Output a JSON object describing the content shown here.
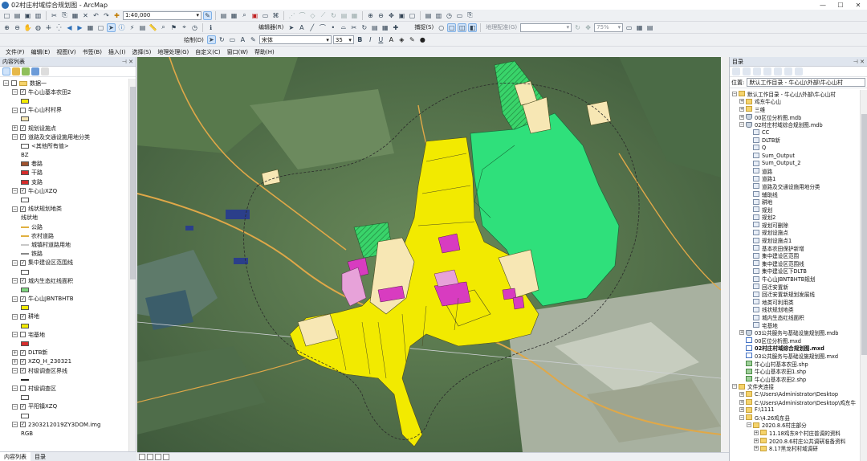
{
  "window": {
    "title": "02村庄村域综合规划图 - ArcMap",
    "controls": [
      "—",
      "☐",
      "✕"
    ]
  },
  "toolbar": {
    "scale": "1:40,000",
    "draw_label": "绘制(D)",
    "font_name": "宋体",
    "font_size": "35",
    "editor_label": "编辑器(R)",
    "snap_label": "捕捉(S)",
    "georef_label": "地理配准(G)",
    "zoom_pct": "75%"
  },
  "menu": [
    "文件(F)",
    "编辑(E)",
    "视图(V)",
    "书签(B)",
    "插入(I)",
    "选择(S)",
    "地理处理(G)",
    "自定义(C)",
    "窗口(W)",
    "帮助(H)"
  ],
  "toc": {
    "title": "内容列表",
    "tabs": [
      "内容列表",
      "目录"
    ],
    "rows": [
      {
        "depth": 0,
        "exp": "−",
        "chk": false,
        "icon": "folder",
        "label": "数据一"
      },
      {
        "depth": 1,
        "exp": "−",
        "chk": true,
        "label": "牛心山基本农田2"
      },
      {
        "depth": 2,
        "swatch": "#f2ea00",
        "label": ""
      },
      {
        "depth": 1,
        "exp": "−",
        "chk": false,
        "label": "牛心山村村界"
      },
      {
        "depth": 2,
        "swatch": "#f7e7b4",
        "label": ""
      },
      {
        "depth": 1,
        "exp": "+",
        "chk": true,
        "label": "规划设施点"
      },
      {
        "depth": 1,
        "exp": "−",
        "chk": true,
        "label": "道路及交通设施用地分类"
      },
      {
        "depth": 2,
        "swatch": "#ffffff",
        "label": "<其他所有值>"
      },
      {
        "depth": 2,
        "label": "BZ"
      },
      {
        "depth": 2,
        "swatch": "#a0522d",
        "label": "巷路"
      },
      {
        "depth": 2,
        "swatch": "#d62c2c",
        "label": "干路"
      },
      {
        "depth": 2,
        "swatch": "#d62c2c",
        "label": "支路"
      },
      {
        "depth": 1,
        "exp": "−",
        "chk": true,
        "label": "牛心山XZQ"
      },
      {
        "depth": 2,
        "swatch": "#ffffff",
        "label": ""
      },
      {
        "depth": 1,
        "exp": "−",
        "chk": true,
        "label": "线状规划地类"
      },
      {
        "depth": 2,
        "label": "线状地"
      },
      {
        "depth": 2,
        "line": "#e0b040",
        "label": "公路"
      },
      {
        "depth": 2,
        "line": "#e0b040",
        "label": "农村道路"
      },
      {
        "depth": 2,
        "line": "#c8c8c8",
        "label": "城镇村道路用地"
      },
      {
        "depth": 2,
        "line": "#888888",
        "label": "铁路"
      },
      {
        "depth": 1,
        "exp": "−",
        "chk": true,
        "label": "集中建设区范围线"
      },
      {
        "depth": 2,
        "swatch": "#ffffff",
        "label": ""
      },
      {
        "depth": 1,
        "exp": "−",
        "chk": true,
        "label": "城内生态红线面积"
      },
      {
        "depth": 2,
        "swatch": "#7fd67f",
        "label": ""
      },
      {
        "depth": 1,
        "exp": "−",
        "chk": true,
        "label": "牛心山JBNTBHTB"
      },
      {
        "depth": 2,
        "swatch": "#f2ea00",
        "label": ""
      },
      {
        "depth": 1,
        "exp": "−",
        "chk": true,
        "label": "耕地"
      },
      {
        "depth": 2,
        "swatch": "#f2ea00",
        "label": ""
      },
      {
        "depth": 1,
        "exp": "−",
        "chk": false,
        "label": "宅基地"
      },
      {
        "depth": 2,
        "swatch": "#d62c2c",
        "label": ""
      },
      {
        "depth": 1,
        "exp": "+",
        "chk": true,
        "label": "DLTB新"
      },
      {
        "depth": 1,
        "exp": "+",
        "chk": true,
        "label": "XZQ_H_230321"
      },
      {
        "depth": 1,
        "exp": "−",
        "chk": true,
        "label": "村级调查区界线"
      },
      {
        "depth": 2,
        "line": "#222222",
        "label": ""
      },
      {
        "depth": 1,
        "exp": "−",
        "chk": false,
        "label": "村级调查区"
      },
      {
        "depth": 2,
        "swatch": "#ffffff",
        "label": ""
      },
      {
        "depth": 1,
        "exp": "−",
        "chk": true,
        "label": "平阳镇XZQ"
      },
      {
        "depth": 2,
        "swatch": "#ffffff",
        "label": ""
      },
      {
        "depth": 1,
        "exp": "−",
        "chk": true,
        "label": "2303212019ZY3DOM.img"
      },
      {
        "depth": 2,
        "label": "RGB"
      }
    ]
  },
  "catalog": {
    "title": "目录",
    "location_label": "位置:",
    "location_value": "默认工作目录 - 牛心山\\外部\\牛心山村",
    "rows": [
      {
        "depth": 0,
        "exp": "−",
        "icon": "folder",
        "label": "默认工作目录 - 牛心山\\外部\\牛心山村"
      },
      {
        "depth": 1,
        "exp": "+",
        "icon": "folder",
        "label": "鸡东牛心山"
      },
      {
        "depth": 1,
        "exp": "+",
        "icon": "folder",
        "label": "三维"
      },
      {
        "depth": 1,
        "exp": "+",
        "icon": "db",
        "label": "00区位分析图.mdb"
      },
      {
        "depth": 1,
        "exp": "−",
        "icon": "db",
        "label": "02村庄村域综合规划图.mdb"
      },
      {
        "depth": 2,
        "icon": "fc",
        "label": "CC"
      },
      {
        "depth": 2,
        "icon": "fc",
        "label": "DLTB新"
      },
      {
        "depth": 2,
        "icon": "fc",
        "label": "Q"
      },
      {
        "depth": 2,
        "icon": "fc",
        "label": "Sum_Output"
      },
      {
        "depth": 2,
        "icon": "fc",
        "label": "Sum_Output_2"
      },
      {
        "depth": 2,
        "icon": "fc",
        "label": "道路"
      },
      {
        "depth": 2,
        "icon": "fc",
        "label": "道路1"
      },
      {
        "depth": 2,
        "icon": "fc",
        "label": "道路及交通设施用地分类"
      },
      {
        "depth": 2,
        "icon": "fc",
        "label": "辅助线"
      },
      {
        "depth": 2,
        "icon": "fc",
        "label": "耕地"
      },
      {
        "depth": 2,
        "icon": "fc",
        "label": "规划"
      },
      {
        "depth": 2,
        "icon": "fc",
        "label": "规划2"
      },
      {
        "depth": 2,
        "icon": "fc",
        "label": "规划可删除"
      },
      {
        "depth": 2,
        "icon": "fc",
        "label": "规划设施点"
      },
      {
        "depth": 2,
        "icon": "fc",
        "label": "规划设施点1"
      },
      {
        "depth": 2,
        "icon": "fc",
        "label": "基本农田保护新增"
      },
      {
        "depth": 2,
        "icon": "fc",
        "label": "集中建设区范围"
      },
      {
        "depth": 2,
        "icon": "fc",
        "label": "集中建设区范围线"
      },
      {
        "depth": 2,
        "icon": "fc",
        "label": "集中建设区下DLTB"
      },
      {
        "depth": 2,
        "icon": "fc",
        "label": "牛心山JBNTBHTB规划"
      },
      {
        "depth": 2,
        "icon": "fc",
        "label": "回迁安置新"
      },
      {
        "depth": 2,
        "icon": "fc",
        "label": "回迁安置新规划发展线"
      },
      {
        "depth": 2,
        "icon": "fc",
        "label": "地类可利用类"
      },
      {
        "depth": 2,
        "icon": "fc",
        "label": "线状规划地类"
      },
      {
        "depth": 2,
        "icon": "fc",
        "label": "城内生态红线面积"
      },
      {
        "depth": 2,
        "icon": "fc",
        "label": "宅基地"
      },
      {
        "depth": 1,
        "exp": "+",
        "icon": "db",
        "label": "03公共服务与基础设施规划图.mdb"
      },
      {
        "depth": 1,
        "icon": "mxd",
        "label": "00区位分析图.mxd"
      },
      {
        "depth": 1,
        "icon": "mxd",
        "label": "02村庄村域综合规划图.mxd",
        "bold": true
      },
      {
        "depth": 1,
        "icon": "mxd",
        "label": "03公共服务与基础设施规划图.mxd"
      },
      {
        "depth": 1,
        "icon": "shp",
        "label": "牛心山村基本农田.shp"
      },
      {
        "depth": 1,
        "icon": "shp",
        "label": "牛心山基本农田1.shp"
      },
      {
        "depth": 1,
        "icon": "shp",
        "label": "牛心山基本农田2.shp"
      },
      {
        "depth": 0,
        "exp": "−",
        "icon": "folder",
        "label": "文件夹连接"
      },
      {
        "depth": 1,
        "exp": "+",
        "icon": "folder",
        "label": "C:\\Users\\Administrator\\Desktop"
      },
      {
        "depth": 1,
        "exp": "+",
        "icon": "folder",
        "label": "C:\\Users\\Administrator\\Desktop\\鸡东牛"
      },
      {
        "depth": 1,
        "exp": "+",
        "icon": "folder",
        "label": "F:\\1111"
      },
      {
        "depth": 1,
        "exp": "−",
        "icon": "folder",
        "label": "G:\\4.26鸡东县"
      },
      {
        "depth": 2,
        "exp": "−",
        "icon": "folder",
        "label": "2020.8.6村庄部分"
      },
      {
        "depth": 3,
        "exp": "+",
        "icon": "folder",
        "label": "11.18鸡东8个村庄普调的资料"
      },
      {
        "depth": 3,
        "exp": "+",
        "icon": "folder",
        "label": "2020.8.6村庄公共调研准备资料"
      },
      {
        "depth": 3,
        "exp": "+",
        "icon": "folder",
        "label": "8.17黑龙村村域调研"
      }
    ]
  },
  "colors": {
    "farmland": "#f2ea00",
    "village": "#f7e7b4",
    "ecology": "#2fe07b",
    "construction": "#d83cc0",
    "road": "#e0a848"
  }
}
